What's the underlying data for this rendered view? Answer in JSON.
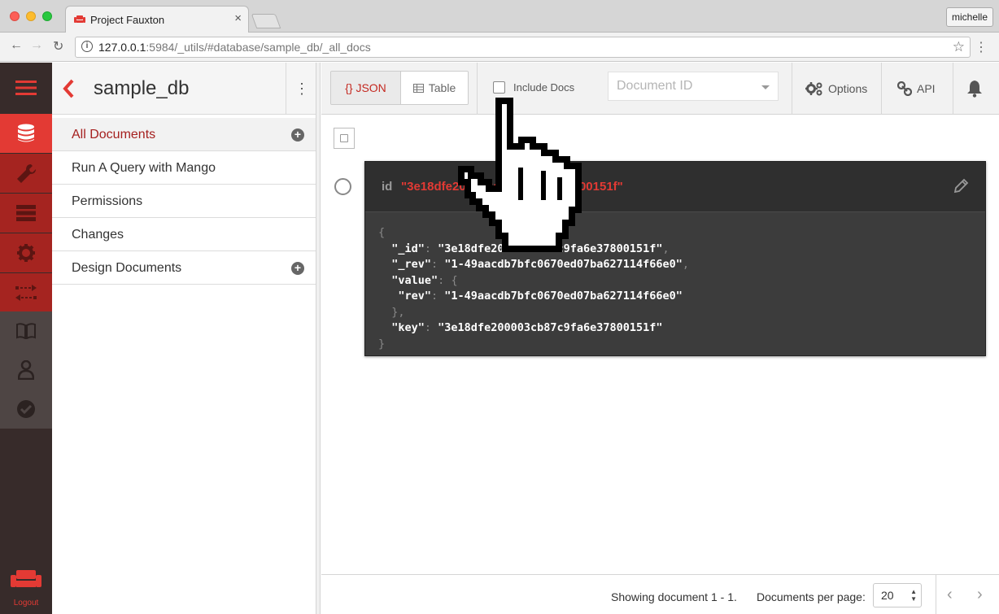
{
  "browser": {
    "tab_title": "Project Fauxton",
    "tab_close": "×",
    "user_badge": "michelle",
    "url_host": "127.0.0.1",
    "url_rest": ":5984/_utils/#database/sample_db/_all_docs",
    "bookmark_star": "☆",
    "menu_kebab": "⋮",
    "back": "←",
    "forward": "→",
    "reload": "↻"
  },
  "colors": {
    "brand_red": "#e33a34",
    "active_red": "#a5201f",
    "icon_sidebar_bg": "#372b2a",
    "card_bg": "#3c3c3c"
  },
  "icon_sidebar": {
    "items": [
      {
        "icon": "hamburger-icon"
      },
      {
        "icon": "database-icon"
      },
      {
        "icon": "wrench-icon"
      },
      {
        "icon": "server-list-icon"
      },
      {
        "icon": "gear-icon"
      },
      {
        "icon": "replication-icon"
      },
      {
        "icon": "book-icon"
      },
      {
        "icon": "user-icon"
      },
      {
        "icon": "checkmark-icon"
      }
    ],
    "logout_label": "Logout"
  },
  "db": {
    "name": "sample_db",
    "kebab": "⋮"
  },
  "sidenav": {
    "items": [
      {
        "label": "All Documents",
        "active": true,
        "has_add": true
      },
      {
        "label": "Run A Query with Mango",
        "active": false,
        "has_add": false
      },
      {
        "label": "Permissions",
        "active": false,
        "has_add": false
      },
      {
        "label": "Changes",
        "active": false,
        "has_add": false
      },
      {
        "label": "Design Documents",
        "active": false,
        "has_add": true
      }
    ],
    "add_symbol": "+"
  },
  "toolbar": {
    "json_label": "{} JSON",
    "table_label": "Table",
    "include_docs_label": "Include Docs",
    "include_docs_checked": false,
    "doc_id_placeholder": "Document ID",
    "options_label": "Options",
    "api_label": "API"
  },
  "document": {
    "id_key": "id",
    "id_value": "\"3e18dfe200003cb87c9fa6e37800151f\"",
    "json": {
      "open": "{",
      "id_key": "\"_id\"",
      "id_val": "\"3e18dfe200003cb87c9fa6e37800151f\"",
      "rev_key": "\"_rev\"",
      "rev_val": "\"1-49aacdb7bfc0670ed07ba627114f66e0\"",
      "value_key": "\"value\"",
      "value_open": "{",
      "value_rev_key": "\"rev\"",
      "value_rev_val": "\"1-49aacdb7bfc0670ed07ba627114f66e0\"",
      "value_close": "},",
      "key_key": "\"key\"",
      "key_val": "\"3e18dfe200003cb87c9fa6e37800151f\"",
      "close": "}"
    }
  },
  "footer": {
    "showing": "Showing document 1 - 1.",
    "per_page_label": "Documents per page:",
    "per_page_value": "20",
    "select_arrows": "▲▼",
    "prev": "‹",
    "next": "›"
  }
}
